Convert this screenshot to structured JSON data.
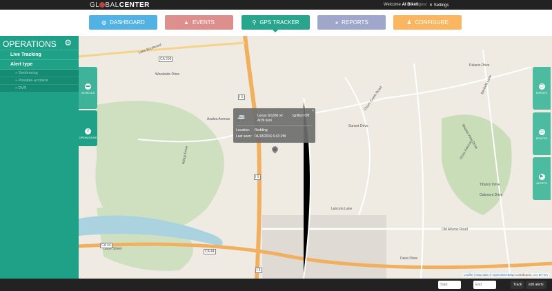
{
  "header": {
    "logo": "GLOBALCENTER",
    "welcome_prefix": "Welcome",
    "user": "Al Biketi",
    "logout": "Logout",
    "settings": "Settings"
  },
  "nav": [
    {
      "label": "DASHBOARD",
      "color": "#4aaee3",
      "icon": "dashboard-icon",
      "glyph": "◍"
    },
    {
      "label": "EVENTS",
      "color": "#dc8a88",
      "icon": "warning-icon",
      "glyph": "▲"
    },
    {
      "label": "GPS TRACKER",
      "color": "#1fa187",
      "icon": "location-icon",
      "glyph": "⚲",
      "active": true
    },
    {
      "label": "REPORTS",
      "color": "#9aa4c8",
      "icon": "chart-icon",
      "glyph": "◕"
    },
    {
      "label": "CONFIGURE",
      "color": "#fbb35a",
      "icon": "user-icon",
      "glyph": "♟"
    }
  ],
  "sidebar": {
    "title": "OPERATIONS",
    "items": [
      {
        "label": "Live Tracking"
      },
      {
        "label": "Alert type"
      }
    ],
    "subitems": [
      {
        "label": "» Geofencing"
      },
      {
        "label": "» Possible accident"
      },
      {
        "label": "» DVR"
      }
    ]
  },
  "left_tabs": [
    {
      "label": "VEHICLES"
    },
    {
      "label": "OPERATIONS"
    }
  ],
  "right_tabs": [
    {
      "label": "EVENTS"
    },
    {
      "label": "ROUTES"
    },
    {
      "label": "ALERTS"
    }
  ],
  "popup": {
    "vehicle": "Lexus GS350 v2",
    "driver": "Al Bi kuni",
    "status": "Ignition Off",
    "location_label": "Location:",
    "location": "Redding",
    "last_seen_label": "Last seen:",
    "last_seen": "04/18/2016 6:43 PM"
  },
  "map": {
    "labels": [
      "Hilltop Drive",
      "Woodside Drive",
      "Shasta View Drive",
      "Dana Drive",
      "Old Alturas Road",
      "Churn Creek Road",
      "Bechelli Lane",
      "Victor Avenue",
      "Tibuton Drive",
      "Oakmont Drive",
      "Lancers Lane",
      "Sunset Drive",
      "Palacio Drive",
      "Azalea Avenue",
      "Lake Boulevard",
      "Butte Street"
    ],
    "shields": [
      "I 5",
      "I 5",
      "I 5",
      "CA 44",
      "CA 44",
      "CA 299"
    ],
    "attribution_prefix": "Leaflet | Map data ©",
    "attribution_osm": "OpenStreetMap",
    "attribution_mid": "contributors,",
    "attribution_license": "CC-BY-SA"
  },
  "footer": {
    "start_placeholder": "Start",
    "end_placeholder": "End",
    "track": "Track",
    "edit_alerts": "edit alerts"
  }
}
